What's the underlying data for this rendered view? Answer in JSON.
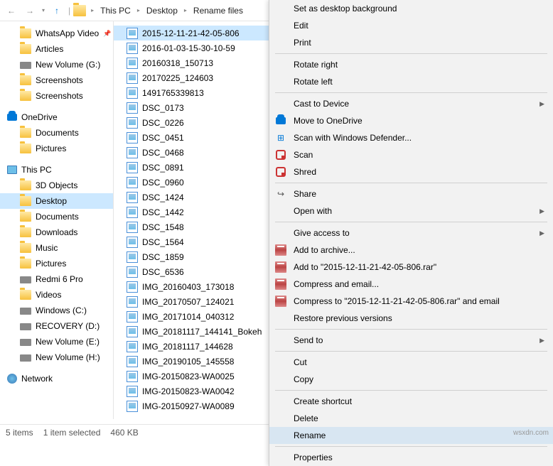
{
  "breadcrumb": [
    "This PC",
    "Desktop",
    "Rename files"
  ],
  "tree": {
    "quick": [
      {
        "name": "WhatsApp Video",
        "type": "fld",
        "pin": true
      },
      {
        "name": "Articles",
        "type": "fld"
      },
      {
        "name": "New Volume (G:)",
        "type": "drv"
      },
      {
        "name": "Screenshots",
        "type": "fld"
      },
      {
        "name": "Screenshots",
        "type": "fld"
      }
    ],
    "onedrive": {
      "label": "OneDrive",
      "items": [
        {
          "name": "Documents",
          "type": "fld"
        },
        {
          "name": "Pictures",
          "type": "fld"
        }
      ]
    },
    "thispc": {
      "label": "This PC",
      "items": [
        {
          "name": "3D Objects",
          "type": "fld"
        },
        {
          "name": "Desktop",
          "type": "fld",
          "sel": true
        },
        {
          "name": "Documents",
          "type": "fld"
        },
        {
          "name": "Downloads",
          "type": "fld"
        },
        {
          "name": "Music",
          "type": "fld"
        },
        {
          "name": "Pictures",
          "type": "fld"
        },
        {
          "name": "Redmi 6 Pro",
          "type": "drv"
        },
        {
          "name": "Videos",
          "type": "fld"
        },
        {
          "name": "Windows (C:)",
          "type": "drv"
        },
        {
          "name": "RECOVERY (D:)",
          "type": "drv"
        },
        {
          "name": "New Volume (E:)",
          "type": "drv"
        },
        {
          "name": "New Volume (H:)",
          "type": "drv"
        }
      ]
    },
    "network": {
      "label": "Network"
    }
  },
  "files": [
    "2015-12-11-21-42-05-806",
    "2016-01-03-15-30-10-59",
    "20160318_150713",
    "20170225_124603",
    "1491765339813",
    "DSC_0173",
    "DSC_0226",
    "DSC_0451",
    "DSC_0468",
    "DSC_0891",
    "DSC_0960",
    "DSC_1424",
    "DSC_1442",
    "DSC_1548",
    "DSC_1564",
    "DSC_1859",
    "DSC_6536",
    "IMG_20160403_173018",
    "IMG_20170507_124021",
    "IMG_20171014_040312",
    "IMG_20181117_144141_Bokeh",
    "IMG_20181117_144628",
    "IMG_20190105_145558",
    "IMG-20150823-WA0025",
    "IMG-20150823-WA0042",
    "IMG-20150927-WA0089"
  ],
  "menu": [
    {
      "t": "Set as desktop background"
    },
    {
      "t": "Edit"
    },
    {
      "t": "Print"
    },
    {
      "sep": true
    },
    {
      "t": "Rotate right"
    },
    {
      "t": "Rotate left"
    },
    {
      "sep": true
    },
    {
      "t": "Cast to Device",
      "sub": true
    },
    {
      "t": "Move to OneDrive",
      "ico": "od"
    },
    {
      "t": "Scan with Windows Defender...",
      "ico": "shield"
    },
    {
      "t": "Scan",
      "ico": "mc"
    },
    {
      "t": "Shred",
      "ico": "mc"
    },
    {
      "sep": true
    },
    {
      "t": "Share",
      "ico": "share"
    },
    {
      "t": "Open with",
      "sub": true
    },
    {
      "sep": true
    },
    {
      "t": "Give access to",
      "sub": true
    },
    {
      "t": "Add to archive...",
      "ico": "rar"
    },
    {
      "t": "Add to \"2015-12-11-21-42-05-806.rar\"",
      "ico": "rar"
    },
    {
      "t": "Compress and email...",
      "ico": "rar"
    },
    {
      "t": "Compress to \"2015-12-11-21-42-05-806.rar\" and email",
      "ico": "rar"
    },
    {
      "t": "Restore previous versions"
    },
    {
      "sep": true
    },
    {
      "t": "Send to",
      "sub": true
    },
    {
      "sep": true
    },
    {
      "t": "Cut"
    },
    {
      "t": "Copy"
    },
    {
      "sep": true
    },
    {
      "t": "Create shortcut"
    },
    {
      "t": "Delete"
    },
    {
      "t": "Rename",
      "hl": true
    },
    {
      "sep": true
    },
    {
      "t": "Properties"
    }
  ],
  "status": {
    "items": "5 items",
    "sel": "1 item selected",
    "size": "460 KB"
  },
  "watermark": "wsxdn.com"
}
